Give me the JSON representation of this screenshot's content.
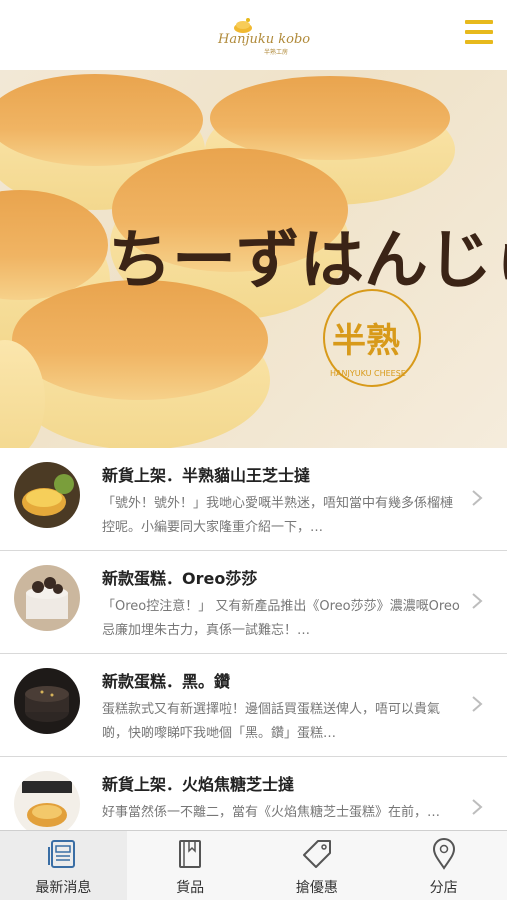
{
  "header": {
    "logo_text": "Hanjuku kobo",
    "logo_sub": "半熟工房",
    "menu_icon": "hamburger-menu-icon"
  },
  "hero": {
    "headline": "ちーずはんじゅく",
    "stamp_text": "半熟",
    "stamp_sub": "HANJYUKU CHEESE"
  },
  "news": [
    {
      "title": "新貨上架．半熟貓山王芝士撻",
      "body": "「號外！號外！」我哋心愛嘅半熟迷，唔知當中有幾多係榴槤控呢。小編要同大家隆重介紹一下，…"
    },
    {
      "title": "新款蛋糕．Oreo莎莎",
      "body": "「Oreo控注意！」 又有新產品推出《Oreo莎莎》濃濃嘅Oreo忌廉加埋朱古力，真係一試難忘！…"
    },
    {
      "title": "新款蛋糕．黑。鑽",
      "body": "蛋糕款式又有新選擇啦！邊個話買蛋糕送俾人，唔可以貴氣啲，快啲嚟睇吓我哋個「黑。鑽」蛋糕…"
    },
    {
      "title": "新貨上架．火焰焦糖芝士撻",
      "body": "好事當然係一不離二，當有《火焰焦糖芝士蛋糕》在前，…"
    }
  ],
  "tabs": [
    {
      "label": "最新消息",
      "icon": "news-icon"
    },
    {
      "label": "貨品",
      "icon": "book-icon"
    },
    {
      "label": "搶優惠",
      "icon": "tag-icon"
    },
    {
      "label": "分店",
      "icon": "location-pin-icon"
    }
  ],
  "colors": {
    "accent": "#e7b91c",
    "stamp": "#d89a1a",
    "text_muted": "#777777"
  }
}
